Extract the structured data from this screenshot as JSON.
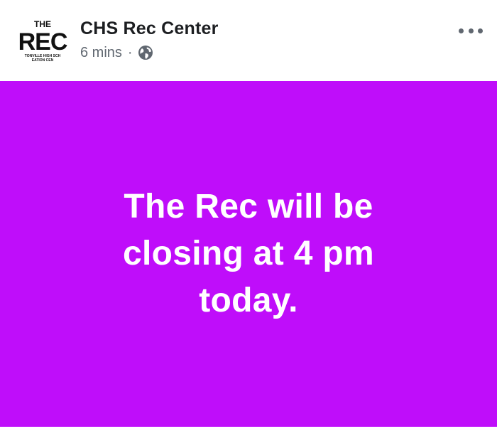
{
  "post": {
    "page_name": "CHS Rec Center",
    "timestamp": "6 mins",
    "separator": "·",
    "privacy_icon": "globe-icon",
    "more_icon": "more-options-icon",
    "avatar": {
      "logo_top": "THE",
      "logo_main": "REC",
      "logo_small_1": "TONVILLE HIGH SCH",
      "logo_small_2": "EATION CEN"
    },
    "status": {
      "line_1": "The Rec will be",
      "line_2": "closing at 4 pm",
      "line_3": "today.",
      "background_color": "#bf0dfa",
      "text_color": "#ffffff"
    }
  }
}
